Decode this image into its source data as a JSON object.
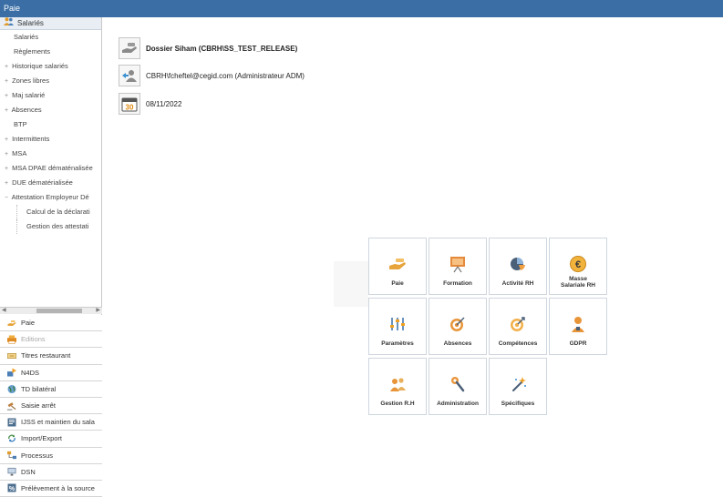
{
  "window": {
    "title": "Paie"
  },
  "sidebar": {
    "section_title": "Salariés",
    "tree": [
      {
        "label": "Salariés",
        "level": "l1n",
        "exp": ""
      },
      {
        "label": "Règlements",
        "level": "l1n",
        "exp": ""
      },
      {
        "label": "Historique salariés",
        "level": "l1",
        "exp": "+"
      },
      {
        "label": "Zones libres",
        "level": "l1",
        "exp": "+"
      },
      {
        "label": "Maj salarié",
        "level": "l1",
        "exp": "+"
      },
      {
        "label": "Absences",
        "level": "l1",
        "exp": "+"
      },
      {
        "label": "BTP",
        "level": "l1n",
        "exp": ""
      },
      {
        "label": "Intermittents",
        "level": "l1",
        "exp": "+"
      },
      {
        "label": "MSA",
        "level": "l1",
        "exp": "+"
      },
      {
        "label": "MSA DPAE dématénalisée",
        "level": "l1",
        "exp": "+"
      },
      {
        "label": "DUE dématérialisée",
        "level": "l1",
        "exp": "+"
      },
      {
        "label": "Attestation Employeur Dé",
        "level": "l1",
        "exp": "−"
      },
      {
        "label": "Calcul de la déclarati",
        "level": "l2",
        "exp": ""
      },
      {
        "label": "Gestion des attestati",
        "level": "l2",
        "exp": ""
      }
    ],
    "modules": [
      {
        "label": "Paie",
        "icon": "hand-coin-icon",
        "disabled": false
      },
      {
        "label": "Editions",
        "icon": "printer-icon",
        "disabled": true
      },
      {
        "label": "Titres restaurant",
        "icon": "ticket-icon",
        "disabled": false
      },
      {
        "label": "N4DS",
        "icon": "n4ds-icon",
        "disabled": false
      },
      {
        "label": "TD bilatéral",
        "icon": "globe-icon",
        "disabled": false
      },
      {
        "label": "Saisie arrêt",
        "icon": "gavel-icon",
        "disabled": false
      },
      {
        "label": "IJSS et maintien du sala",
        "icon": "document-icon",
        "disabled": false
      },
      {
        "label": "Import/Export",
        "icon": "arrows-cycle-icon",
        "disabled": false
      },
      {
        "label": "Processus",
        "icon": "process-icon",
        "disabled": false
      },
      {
        "label": "DSN",
        "icon": "monitor-icon",
        "disabled": false
      },
      {
        "label": "Prélèvement à la source",
        "icon": "tax-icon",
        "disabled": false
      }
    ]
  },
  "main": {
    "dossier": "Dossier Siham (CBRH\\SS_TEST_RELEASE)",
    "user": "CBRH\\fcheftel@cegid.com (Administrateur ADM)",
    "date": "08/11/2022",
    "calendar_day": "30",
    "tiles": [
      {
        "label": "Paie",
        "icon": "hand-coin-icon"
      },
      {
        "label": "Formation",
        "icon": "presentation-board-icon"
      },
      {
        "label": "Activité RH",
        "icon": "pie-chart-icon"
      },
      {
        "label": "Masse Salariale RH",
        "icon": "euro-coin-icon"
      },
      {
        "label": "Paramètres",
        "icon": "sliders-icon"
      },
      {
        "label": "Absences",
        "icon": "target-icon"
      },
      {
        "label": "Compétences",
        "icon": "target-arrow-icon"
      },
      {
        "label": "GDPR",
        "icon": "user-shield-icon"
      },
      {
        "label": "Gestion R.H",
        "icon": "users-icon"
      },
      {
        "label": "Administration",
        "icon": "wrench-icon"
      },
      {
        "label": "Spécifiques",
        "icon": "magic-wand-icon"
      }
    ]
  },
  "colors": {
    "titlebar": "#3a6ea5",
    "accent_orange": "#f0a020",
    "accent_blue": "#3a6ea5"
  }
}
